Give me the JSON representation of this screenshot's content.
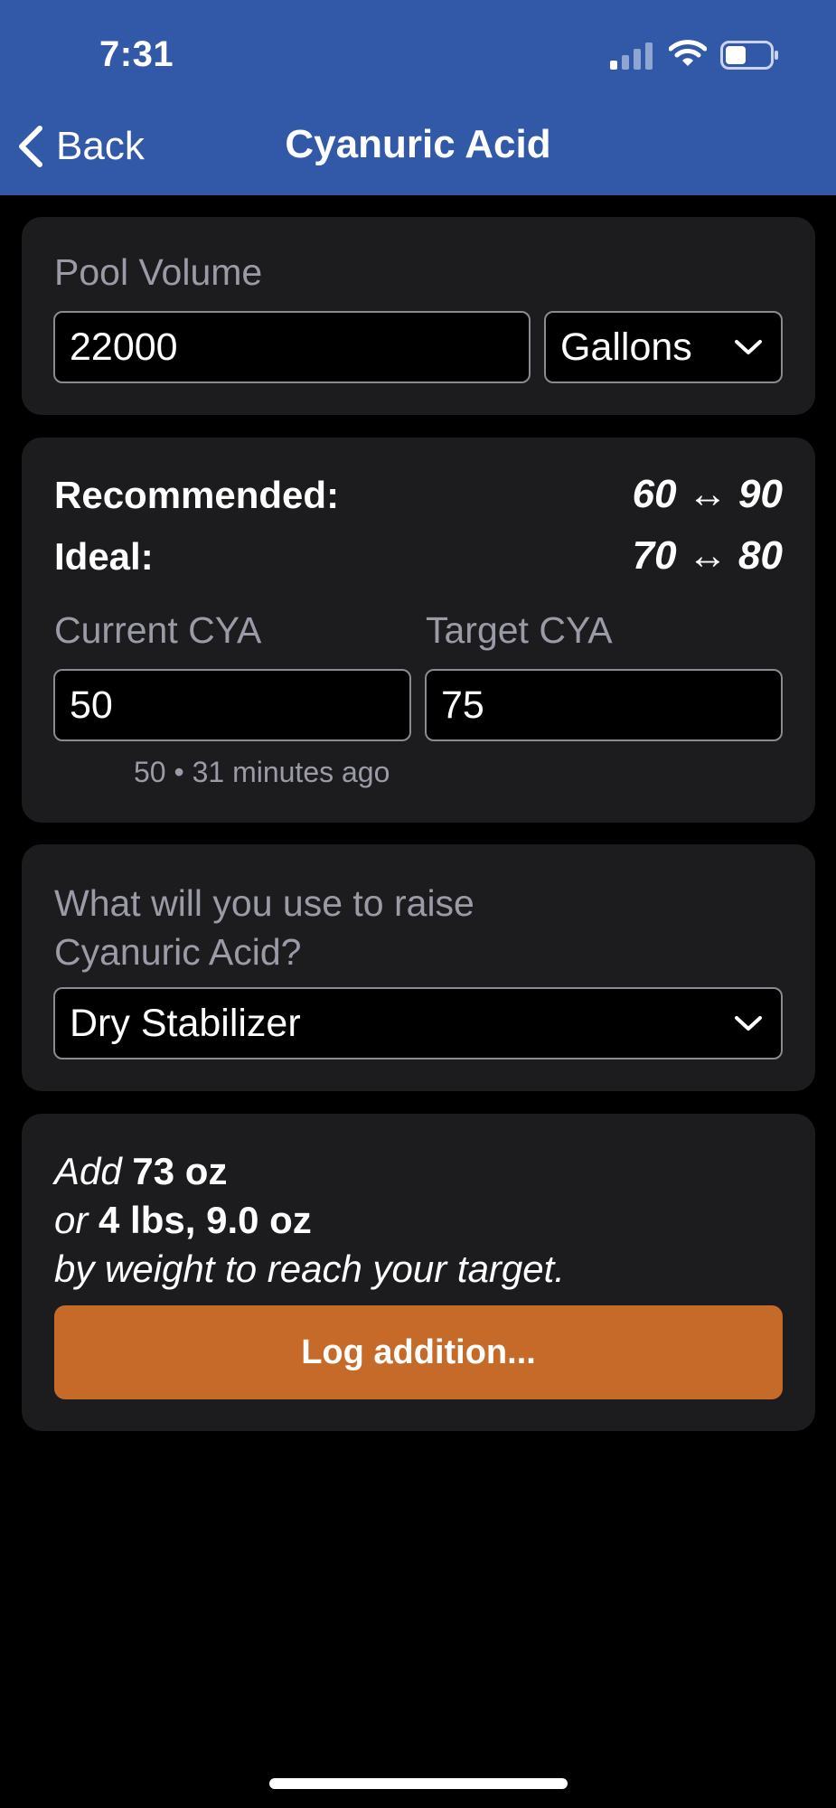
{
  "status_bar": {
    "time": "7:31",
    "signal_icon": "cellular-signal-icon",
    "wifi_icon": "wifi-icon",
    "battery_icon": "battery-icon"
  },
  "nav": {
    "back_label": "Back",
    "back_icon": "chevron-left-icon",
    "title": "Cyanuric Acid"
  },
  "pool_volume": {
    "label": "Pool Volume",
    "value": "22000",
    "unit": "Gallons"
  },
  "ranges": {
    "recommended_label": "Recommended:",
    "recommended_value": "60 ↔ 90",
    "ideal_label": "Ideal:",
    "ideal_value": "70 ↔ 80"
  },
  "cya": {
    "current_label": "Current CYA",
    "current_value": "50",
    "target_label": "Target CYA",
    "target_value": "75",
    "last_reading": "50 • 31 minutes ago"
  },
  "chemical": {
    "question": "What will you use to raise Cyanuric Acid?",
    "selected": "Dry Stabilizer"
  },
  "result": {
    "add_word": "Add",
    "amount_oz": "73 oz",
    "or_word": "or",
    "amount_lbs": "4 lbs, 9.0 oz",
    "suffix": "by weight to reach your target.",
    "button_label": "Log addition..."
  },
  "colors": {
    "header": "#3259A8",
    "card": "#1C1C1E",
    "accent": "#C56A28",
    "muted_text": "#9B9BA8"
  }
}
